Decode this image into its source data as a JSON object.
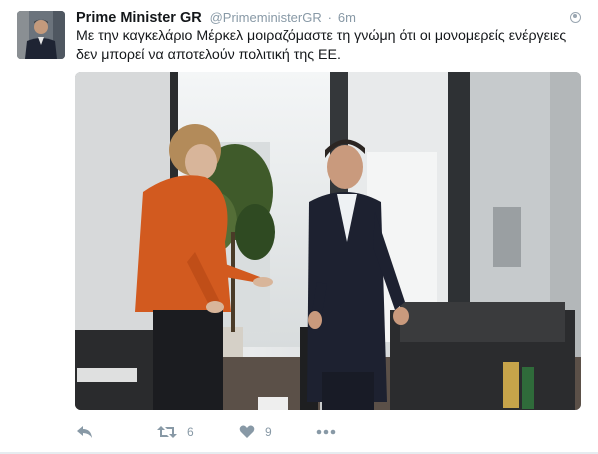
{
  "tweet": {
    "name": "Prime Minister GR",
    "handle": "@PrimeministerGR",
    "separator": "·",
    "time": "6m",
    "text": "Με την καγκελάριο Μέρκελ μοιραζόμαστε τη γνώμη ότι οι μονομερείς ενέργειες δεν μπορεί να αποτελούν πολιτική της ΕΕ.",
    "actions": {
      "reply_icon": "reply-arrow",
      "retweet_icon": "retweet-arrows",
      "retweet_count": "6",
      "like_icon": "heart",
      "like_count": "9",
      "more_icon": "ellipsis"
    }
  },
  "colors": {
    "action_gray": "#8899a6",
    "name_color": "#14171a",
    "coat_orange": "#d25a1f",
    "suit_navy": "#1d2130"
  }
}
